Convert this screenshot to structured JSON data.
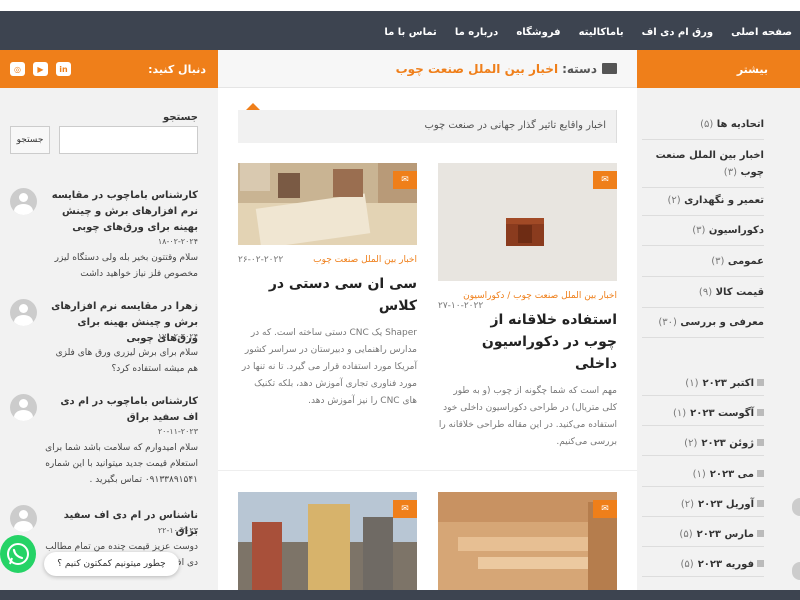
{
  "nav": {
    "items": [
      "صفحه اصلی",
      "ورق ام دی اف",
      "باماکالیته",
      "فروشگاه",
      "درباره ما",
      "تماس با ما"
    ]
  },
  "right_sidebar": {
    "heading": "بیشتر",
    "categories": [
      {
        "label": "اتحادیه ها",
        "count": "(۵)"
      },
      {
        "label": "اخبار بین الملل صنعت چوب",
        "count": "(۳)"
      },
      {
        "label": "تعمیر و نگهداری",
        "count": "(۲)"
      },
      {
        "label": "دکوراسیون",
        "count": "(۳)"
      },
      {
        "label": "عمومی",
        "count": "(۳)"
      },
      {
        "label": "قیمت کالا",
        "count": "(۹)"
      },
      {
        "label": "معرفی و بررسی",
        "count": "(۳۰)"
      }
    ],
    "archives": [
      {
        "label": "اکتبر ۲۰۲۳",
        "count": "(۱)"
      },
      {
        "label": "آگوست ۲۰۲۳",
        "count": "(۱)"
      },
      {
        "label": "ژوئن ۲۰۲۳",
        "count": "(۲)"
      },
      {
        "label": "می ۲۰۲۳",
        "count": "(۱)"
      },
      {
        "label": "آوریل ۲۰۲۳",
        "count": "(۲)"
      },
      {
        "label": "مارس ۲۰۲۳",
        "count": "(۵)"
      },
      {
        "label": "فوریه ۲۰۲۳",
        "count": "(۵)"
      }
    ]
  },
  "main": {
    "heading_prefix": "دسته:",
    "heading_category": "اخبار بین الملل صنعت چوب",
    "description": "اخبار واقایع تاثیر گذار جهانی در صنعت چوب",
    "posts": [
      {
        "category": "اخبار بین الملل صنعت چوب / دکوراسیون",
        "date": "۲۷-۱۰-۲۰۲۲",
        "title": "استفاده خلاقانه از چوب در دکوراسیون داخلی",
        "excerpt": "مهم است که شما چگونه از چوب (و به طور کلی متریال) در طراحی دکوراسیون داخلی خود استفاده می‌کنید. در این مقاله طراحی خلاقانه را بررسی می‌کنیم."
      },
      {
        "category": "اخبار بین الملل صنعت چوب",
        "date": "۲۶-۰۲-۲۰۲۲",
        "title": "سی ان سی دستی در کلاس",
        "excerpt": "Shaper یک CNC دستی ساخته است. که در مدارس راهنمایی و دبیرستان در سراسر کشور آمریکا مورد استفاده قرار می گیرد. تا نه تنها در مورد فناوری تجاری آموزش دهد، بلکه تکنیک های CNC را نیز آموزش دهد."
      }
    ]
  },
  "left_sidebar": {
    "follow_label": "دنبال کنید:",
    "social": [
      "in",
      "▶",
      "◎"
    ],
    "search_label": "جستجو",
    "search_button": "جستجو",
    "comments": [
      {
        "title": "کارشناس باماچوب در مقایسه نرم افزارهای برش و چینش بهینه برای ورق‌های چوبی",
        "date": "۱۸-۰۲-۲۰۲۴",
        "text": "سلام وقتتون بخیر بله ولی دستگاه لیزر مخصوص فلز نیاز خواهید داشت"
      },
      {
        "title": "زهرا در مقایسه نرم افزارهای برش و چینش بهینه برای ورق‌های چوبی",
        "date": "۱۷-۰۲-۲۰۲۴",
        "text": "سلام برای برش لیزری ورق های فلزی هم میشه استفاده کرد؟"
      },
      {
        "title": "کارشناس باماچوب در ام دی اف سفید براق",
        "date": "۲۰-۱۱-۲۰۲۳",
        "text": "سلام امیدوارم که سلامت باشد شما برای استعلام قیمت جدید میتوانید با این شماره ۰۹۱۳۳۸۹۱۵۴۱ تماس بگیرید ."
      },
      {
        "title": "ناشناس در ام دی اف سفید براق",
        "date": "۲۲-۱۰-۲۰۲۳",
        "text": "دوست عزیز قیمت چنده من تمام مطالب دی اف سفید قیمت چنده"
      }
    ]
  },
  "whatsapp": {
    "bubble_text": "چطور میتونیم کمکتون کنیم ؟"
  },
  "colors": {
    "accent": "#ef7f1a",
    "nav": "#3d4450",
    "whatsapp": "#25d366"
  }
}
